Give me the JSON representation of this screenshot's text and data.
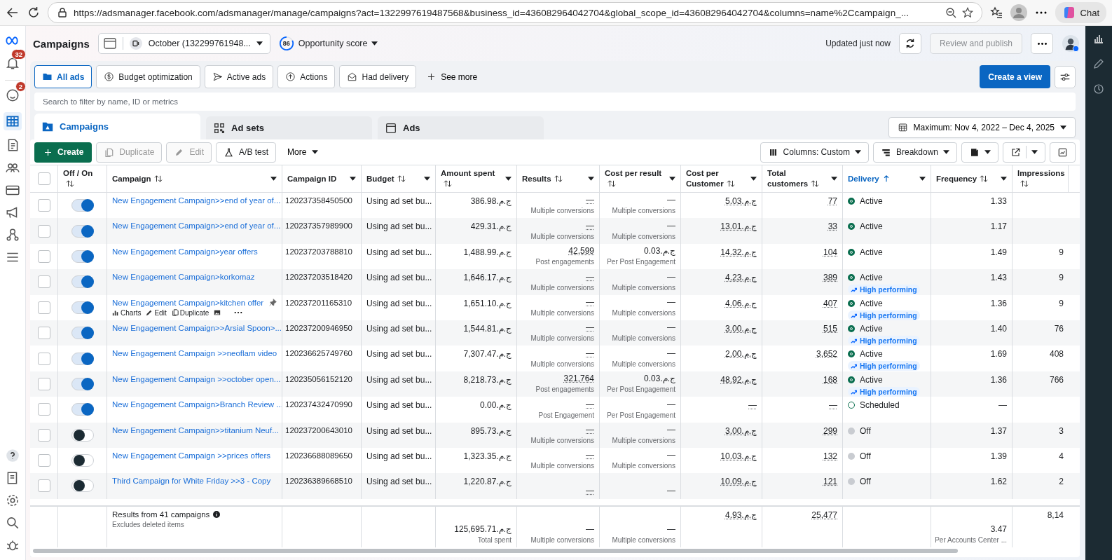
{
  "browser": {
    "url": "https://adsmanager.facebook.com/adsmanager/manage/campaigns?act=1322997619487568&business_id=436082964042704&global_scope_id=436082964042704&columns=name%2Ccampaign_...",
    "chat": "Chat"
  },
  "sidebar": {
    "notifications": "32",
    "messages": "2"
  },
  "header": {
    "title": "Campaigns",
    "account": "October (132299761948...",
    "score": "86",
    "score_label": "Opportunity score",
    "updated": "Updated just now",
    "review": "Review and publish"
  },
  "filters": [
    {
      "label": "All ads",
      "kind": "folder",
      "selected": true
    },
    {
      "label": "Budget optimization",
      "kind": "dollar",
      "selected": false
    },
    {
      "label": "Active ads",
      "kind": "send",
      "selected": false
    },
    {
      "label": "Actions",
      "kind": "up",
      "selected": false
    },
    {
      "label": "Had delivery",
      "kind": "mail",
      "selected": false
    }
  ],
  "see_more": "See more",
  "create_view": "Create a view",
  "search": {
    "placeholder": "Search to filter by name, ID or metrics"
  },
  "level_tabs": [
    {
      "label": "Campaigns",
      "kind": "folder",
      "selected": true
    },
    {
      "label": "Ad sets",
      "kind": "grid",
      "selected": false
    },
    {
      "label": "Ads",
      "kind": "window",
      "selected": false
    }
  ],
  "date_range": "Maximum: Nov 4, 2022 – Dec 4, 2025",
  "toolbar": {
    "create": "Create",
    "actions": [
      {
        "label": "Duplicate",
        "kind": "copy",
        "disabled": true
      },
      {
        "label": "Edit",
        "kind": "pencil",
        "disabled": true
      },
      {
        "label": "A/B test",
        "kind": "flask",
        "disabled": false
      }
    ],
    "more": "More",
    "columns": "Columns: Custom",
    "breakdown": "Breakdown"
  },
  "select_all": {
    "checked": false
  },
  "columns": [
    {
      "label": "Off / On",
      "sortable": true,
      "sorted": false,
      "menu": false
    },
    {
      "label": "Campaign",
      "sortable": true,
      "sorted": false,
      "menu": true
    },
    {
      "label": "Campaign ID",
      "sortable": false,
      "menu": true
    },
    {
      "label": "Budget",
      "sortable": true,
      "sorted": false,
      "menu": true
    },
    {
      "label": "Amount spent",
      "sortable": true,
      "sorted": false,
      "menu": true
    },
    {
      "label": "Results",
      "sortable": true,
      "sorted": false,
      "menu": true
    },
    {
      "label": "Cost per result",
      "sortable": true,
      "sorted": false,
      "menu": true
    },
    {
      "label": "Cost per Customer",
      "sortable": true,
      "sorted": false,
      "menu": true
    },
    {
      "label": "Total customers",
      "sortable": true,
      "sorted": false,
      "menu": true
    },
    {
      "label": "Delivery",
      "sortable": true,
      "sorted": true,
      "menu": true
    },
    {
      "label": "Frequency",
      "sortable": true,
      "sorted": false,
      "menu": true
    },
    {
      "label": "Impressions",
      "sortable": true,
      "sorted": false,
      "menu": false
    }
  ],
  "rows": [
    {
      "checked": false,
      "on": true,
      "name": "New Engagement Campaign>>end of year of...",
      "id": "120237358450500",
      "budget": "Using ad set bu...",
      "spent": "ج.م.386.98",
      "results": "—",
      "results_note": "Multiple conversions",
      "cpr": "—",
      "cpr_note": "Multiple conversions",
      "cpc": "ج.م.5.03",
      "customers": "77",
      "delivery": {
        "kind": "active",
        "label": "Active"
      },
      "frequency": "1.33"
    },
    {
      "checked": false,
      "on": true,
      "name": "New Engagement Campaign>>end of year of...",
      "id": "120237357989900",
      "budget": "Using ad set bu...",
      "spent": "ج.م.429.31",
      "results": "—",
      "results_note": "Multiple conversions",
      "cpr": "—",
      "cpr_note": "Multiple conversions",
      "cpc": "ج.م.13.01",
      "customers": "33",
      "delivery": {
        "kind": "active",
        "label": "Active"
      },
      "frequency": "1.17"
    },
    {
      "checked": false,
      "on": true,
      "name": "New Engagement Campaign>year offers",
      "id": "120237203788810",
      "budget": "Using ad set bu...",
      "spent": "ج.م.1,488.99",
      "results": "42,599",
      "results_note": "Post engagements",
      "cpr": "ج.م.0.03",
      "cpr_note": "Per Post Engagement",
      "cpc": "ج.م.14.32",
      "customers": "104",
      "delivery": {
        "kind": "active",
        "label": "Active"
      },
      "frequency": "1.49",
      "impressions": "9"
    },
    {
      "checked": false,
      "on": true,
      "name": "New Engagement Campaign>korkomaz",
      "id": "120237203518420",
      "budget": "Using ad set bu...",
      "spent": "ج.م.1,646.17",
      "results": "—",
      "results_note": "Multiple conversions",
      "cpr": "—",
      "cpr_note": "Multiple conversions",
      "cpc": "ج.م.4.23",
      "customers": "389",
      "delivery": {
        "kind": "active",
        "label": "Active",
        "badge": "High performing"
      },
      "frequency": "1.43",
      "impressions": "9"
    },
    {
      "checked": false,
      "on": true,
      "name": "New Engagement Campaign>kitchen offer",
      "pinned": true,
      "row_actions": [
        "Charts",
        "Edit",
        "Duplicate"
      ],
      "id": "120237201165310",
      "budget": "Using ad set bu...",
      "spent": "ج.م.1,651.10",
      "results": "—",
      "results_note": "Multiple conversions",
      "cpr": "—",
      "cpr_note": "Multiple conversions",
      "cpc": "ج.م.4.06",
      "customers": "407",
      "delivery": {
        "kind": "active",
        "label": "Active",
        "badge": "High performing"
      },
      "frequency": "1.36",
      "impressions": "9"
    },
    {
      "checked": false,
      "on": true,
      "name": "New Engagement Campaign>>Arsial Spoon>...",
      "id": "120237200946950",
      "budget": "Using ad set bu...",
      "spent": "ج.م.1,544.81",
      "results": "—",
      "results_note": "Multiple conversions",
      "cpr": "—",
      "cpr_note": "Multiple conversions",
      "cpc": "ج.م.3.00",
      "customers": "515",
      "delivery": {
        "kind": "active",
        "label": "Active",
        "badge": "High performing"
      },
      "frequency": "1.40",
      "impressions": "76"
    },
    {
      "checked": false,
      "on": true,
      "name": "New Engagement Campaign >>neoflam video",
      "id": "120236625749760",
      "budget": "Using ad set bu...",
      "spent": "ج.م.7,307.47",
      "results": "—",
      "results_note": "Multiple conversions",
      "cpr": "—",
      "cpr_note": "Multiple conversions",
      "cpc": "ج.م.2.00",
      "customers": "3,652",
      "delivery": {
        "kind": "active",
        "label": "Active",
        "badge": "High performing"
      },
      "frequency": "1.69",
      "impressions": "408"
    },
    {
      "checked": false,
      "on": true,
      "name": "New Engagement Campaign >>october open...",
      "id": "120235056152120",
      "budget": "Using ad set bu...",
      "spent": "ج.م.8,218.73",
      "results": "321,764",
      "results_note": "Post engagements",
      "cpr": "ج.م.0.03",
      "cpr_note": "Per Post Engagement",
      "cpc": "ج.م.48.92",
      "customers": "168",
      "delivery": {
        "kind": "active",
        "label": "Active",
        "badge": "High performing"
      },
      "frequency": "1.36",
      "impressions": "766"
    },
    {
      "checked": false,
      "on": true,
      "name": "New Engagement Campaign>Branch Review ...",
      "id": "120237432470990",
      "budget": "Using ad set bu...",
      "spent": "ج.م.0.00",
      "results": "—",
      "results_note": "Post Engagement",
      "cpr": "—",
      "cpr_note": "Per Post Engagement",
      "cpc": "—",
      "customers": "—",
      "delivery": {
        "kind": "scheduled",
        "label": "Scheduled"
      },
      "frequency": "—"
    },
    {
      "checked": false,
      "on": false,
      "name": "New Engagement Campaign>>titanium Neuf...",
      "id": "120237200643010",
      "budget": "Using ad set bu...",
      "spent": "ج.م.895.73",
      "results": "—",
      "results_note": "Multiple conversions",
      "cpr": "—",
      "cpr_note": "Multiple conversions",
      "cpc": "ج.م.3.00",
      "customers": "299",
      "delivery": {
        "kind": "off",
        "label": "Off"
      },
      "frequency": "1.37",
      "impressions": "3"
    },
    {
      "checked": false,
      "on": false,
      "name": "New Engagement Campaign >>prices offers",
      "id": "120236688089650",
      "budget": "Using ad set bu...",
      "spent": "ج.م.1,323.35",
      "results": "—",
      "results_note": "Multiple conversions",
      "cpr": "—",
      "cpr_note": "Multiple conversions",
      "cpc": "ج.م.10.03",
      "customers": "132",
      "delivery": {
        "kind": "off",
        "label": "Off"
      },
      "frequency": "1.39",
      "impressions": "4"
    },
    {
      "checked": false,
      "on": false,
      "name": "Third Campaign for White Friday >>3 - Copy",
      "id": "120236389668510",
      "budget": "Using ad set bu...",
      "spent": "ج.م.1,220.87",
      "results": "—",
      "cpr": "—",
      "cpc": "ج.م.10.09",
      "customers": "121",
      "delivery": {
        "kind": "off",
        "label": "Off"
      },
      "frequency": "1.62",
      "impressions": "2"
    }
  ],
  "summary": {
    "title": "Results from 41 campaigns",
    "note": "Excludes deleted items",
    "spent": "ج.م.125,695.71",
    "spent_note": "Total spent",
    "results": "—",
    "results_note": "Multiple conversions",
    "cpr": "—",
    "cpr_note": "Multiple conversions",
    "cpc": "ج.م.4.93",
    "customers": "25,477",
    "frequency": "3.47",
    "frequency_note": "Per Accounts Center ...",
    "impressions": "8,14"
  }
}
